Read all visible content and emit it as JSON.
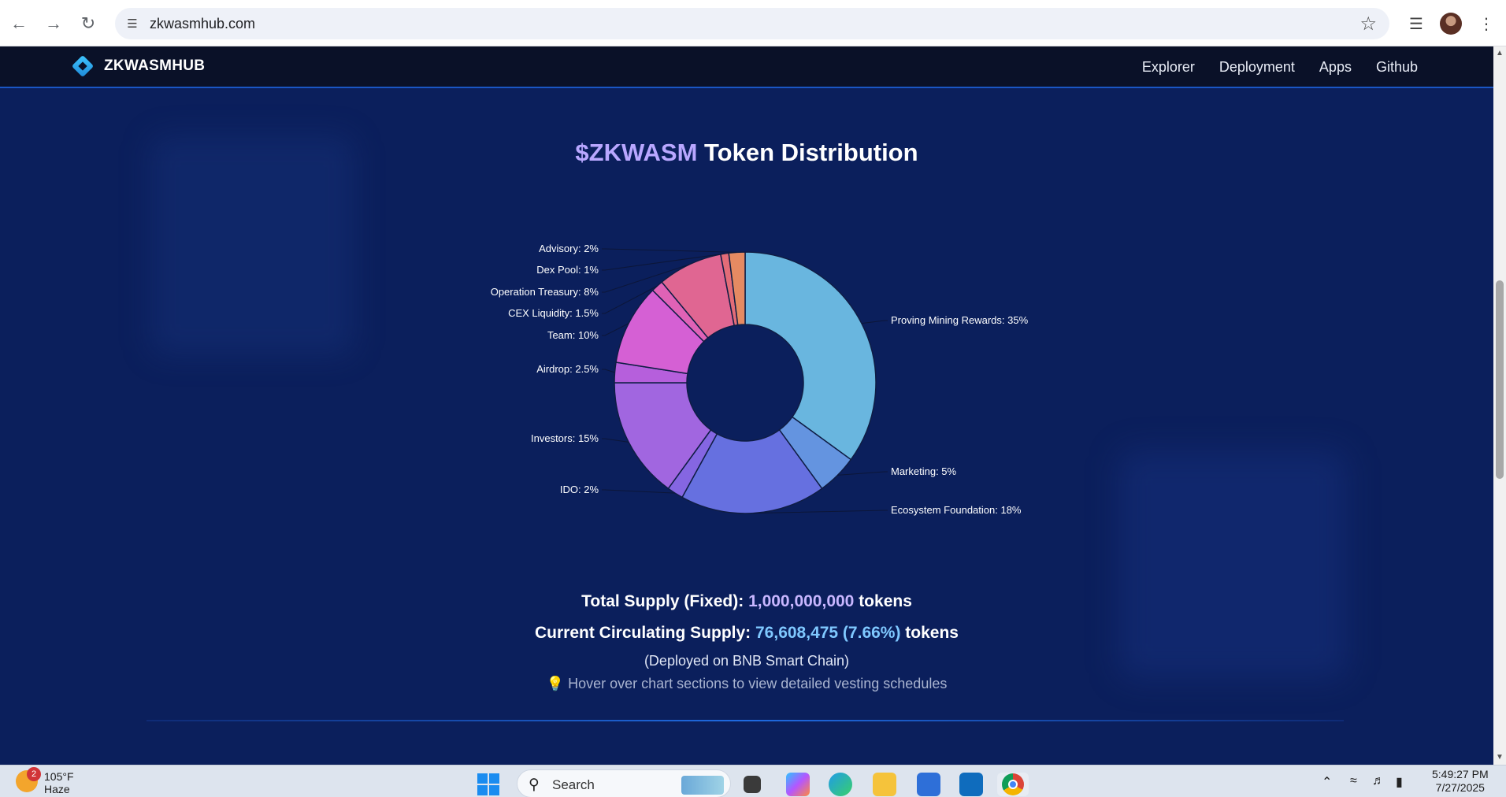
{
  "browser": {
    "url": "zkwasmhub.com",
    "back_icon": "arrow-left-icon",
    "forward_icon": "arrow-right-icon",
    "reload_icon": "reload-icon"
  },
  "site": {
    "logo_text": "ZKWASMHUB",
    "nav": [
      "Explorer",
      "Deployment",
      "Apps",
      "Github"
    ]
  },
  "main": {
    "title_accent": "$ZKWASM",
    "title_rest": " Token Distribution",
    "total_supply_label": "Total Supply (Fixed): ",
    "total_supply_value": "1,000,000,000",
    "total_supply_unit": " tokens",
    "circulating_label": "Current Circulating Supply: ",
    "circulating_value": "76,608,475 (7.66%)",
    "circulating_unit": " tokens",
    "deployed_note": "(Deployed on BNB Smart Chain)",
    "hint_icon": "💡",
    "hint_text": "Hover over chart sections to view detailed vesting schedules"
  },
  "chart_data": {
    "type": "pie",
    "donut": true,
    "series": [
      {
        "label": "Proving Mining Rewards: 35%",
        "value": 35,
        "color": "#69b6df"
      },
      {
        "label": "Marketing: 5%",
        "value": 5,
        "color": "#6494e0"
      },
      {
        "label": "Ecosystem Foundation: 18%",
        "value": 18,
        "color": "#6670e0"
      },
      {
        "label": "IDO: 2%",
        "value": 2,
        "color": "#8566e2"
      },
      {
        "label": "Investors: 15%",
        "value": 15,
        "color": "#a166e0"
      },
      {
        "label": "Airdrop: 2.5%",
        "value": 2.5,
        "color": "#b65fdc"
      },
      {
        "label": "Team: 10%",
        "value": 10,
        "color": "#d560d4"
      },
      {
        "label": "CEX Liquidity: 1.5%",
        "value": 1.5,
        "color": "#e062b6"
      },
      {
        "label": "Operation Treasury: 8%",
        "value": 8,
        "color": "#e06692"
      },
      {
        "label": "Dex Pool: 1%",
        "value": 1,
        "color": "#e36c78"
      },
      {
        "label": "Advisory: 2%",
        "value": 2,
        "color": "#e58a62"
      }
    ]
  },
  "taskbar": {
    "weather_badge": "2",
    "weather_temp": "105°F",
    "weather_desc": "Haze",
    "search_label": "Search",
    "time": "5:49:27 PM",
    "date": "7/27/2025"
  }
}
